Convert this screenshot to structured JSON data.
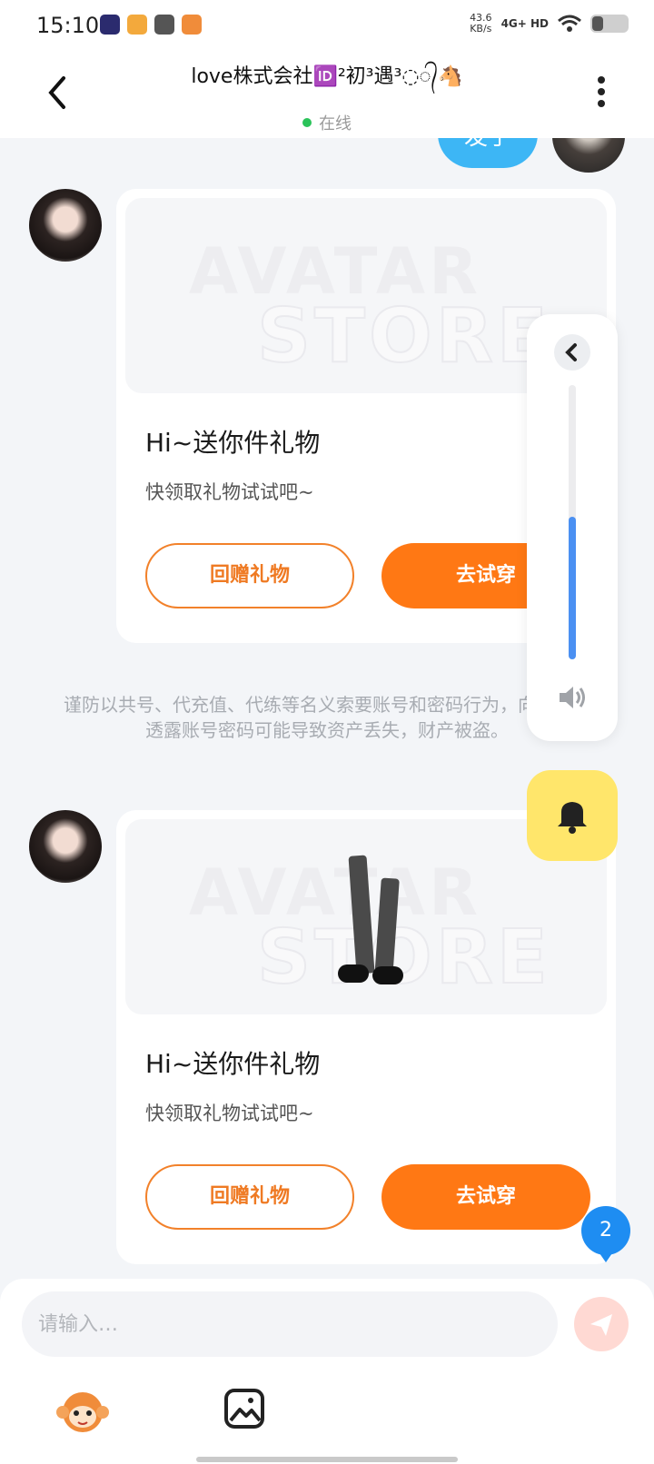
{
  "status_bar": {
    "time": "15:10",
    "net_speed": "43.6",
    "net_unit": "KB/s",
    "net_type": "4G+ HD"
  },
  "header": {
    "back_icon": "chevron-left-icon",
    "title": "love株式会社🆔²初³遇³◌᭄🐴",
    "presence": "在线",
    "more_icon": "more-vertical-icon"
  },
  "previous_message": {
    "text": "发了"
  },
  "messages": [
    {
      "title": "Hi~送你件礼物",
      "subtitle": "快领取礼物试试吧~",
      "return_gift_label": "回赠礼物",
      "try_on_label": "去试穿"
    },
    {
      "title": "Hi~送你件礼物",
      "subtitle": "快领取礼物试试吧~",
      "return_gift_label": "回赠礼物",
      "try_on_label": "去试穿"
    }
  ],
  "warning": "谨防以共号、代充值、代练等名义索要账号和密码行为，向陌生人透露账号密码可能导致资产丢失，财产被盗。",
  "volume_panel": {
    "collapse_icon": "chevron-left-icon",
    "level": 0.52,
    "speaker_icon": "speaker-icon"
  },
  "bell_icon": "bell-icon",
  "unread_count": "2",
  "input": {
    "placeholder": "请输入…",
    "value": ""
  },
  "toolbar": {
    "emoji_icon": "monkey-emoji-icon",
    "image_icon": "image-icon",
    "send_icon": "send-icon"
  },
  "colors": {
    "accent_orange": "#ff7814",
    "bubble_blue": "#3db6f5",
    "online_green": "#2bc35a",
    "volume_blue": "#4b90f2",
    "bell_yellow": "#ffe66b"
  }
}
